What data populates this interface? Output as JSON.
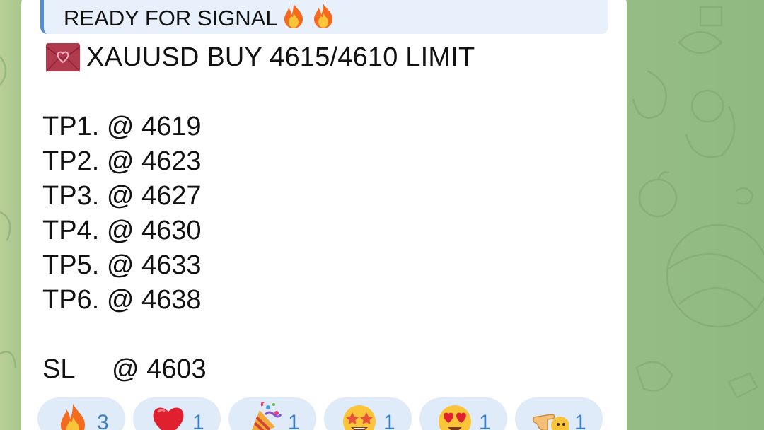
{
  "message": {
    "quote_text": "READY FOR SIGNAL",
    "quote_emoji": [
      "fire-icon",
      "fire-icon"
    ],
    "headline_emoji": "love-letter-icon",
    "headline": "XAUUSD BUY 4615/4610 LIMIT",
    "targets": [
      {
        "label": "TP1.",
        "value": "@ 4619"
      },
      {
        "label": "TP2.",
        "value": "@ 4623"
      },
      {
        "label": "TP3.",
        "value": "@ 4627"
      },
      {
        "label": "TP4.",
        "value": "@ 4630"
      },
      {
        "label": "TP5.",
        "value": "@ 4633"
      },
      {
        "label": "TP6.",
        "value": "@ 4638"
      }
    ],
    "stop_loss": {
      "label": "SL",
      "value": "@ 4603"
    }
  },
  "reactions": [
    {
      "emoji": "fire-icon",
      "count": "3"
    },
    {
      "emoji": "red-heart-icon",
      "count": "1"
    },
    {
      "emoji": "party-popper-icon",
      "count": "1"
    },
    {
      "emoji": "star-struck-icon",
      "count": "1"
    },
    {
      "emoji": "heart-eyes-icon",
      "count": "1"
    },
    {
      "emoji": "pointing-hand-icon",
      "count": "1"
    }
  ],
  "colors": {
    "wallpaper": "#9ec08a",
    "bubble": "#ffffff",
    "quote_background": "#e8f0fb",
    "quote_bar": "#4f8fd6",
    "reaction_background": "#dfebf8",
    "reaction_count": "#3b7ec6"
  }
}
